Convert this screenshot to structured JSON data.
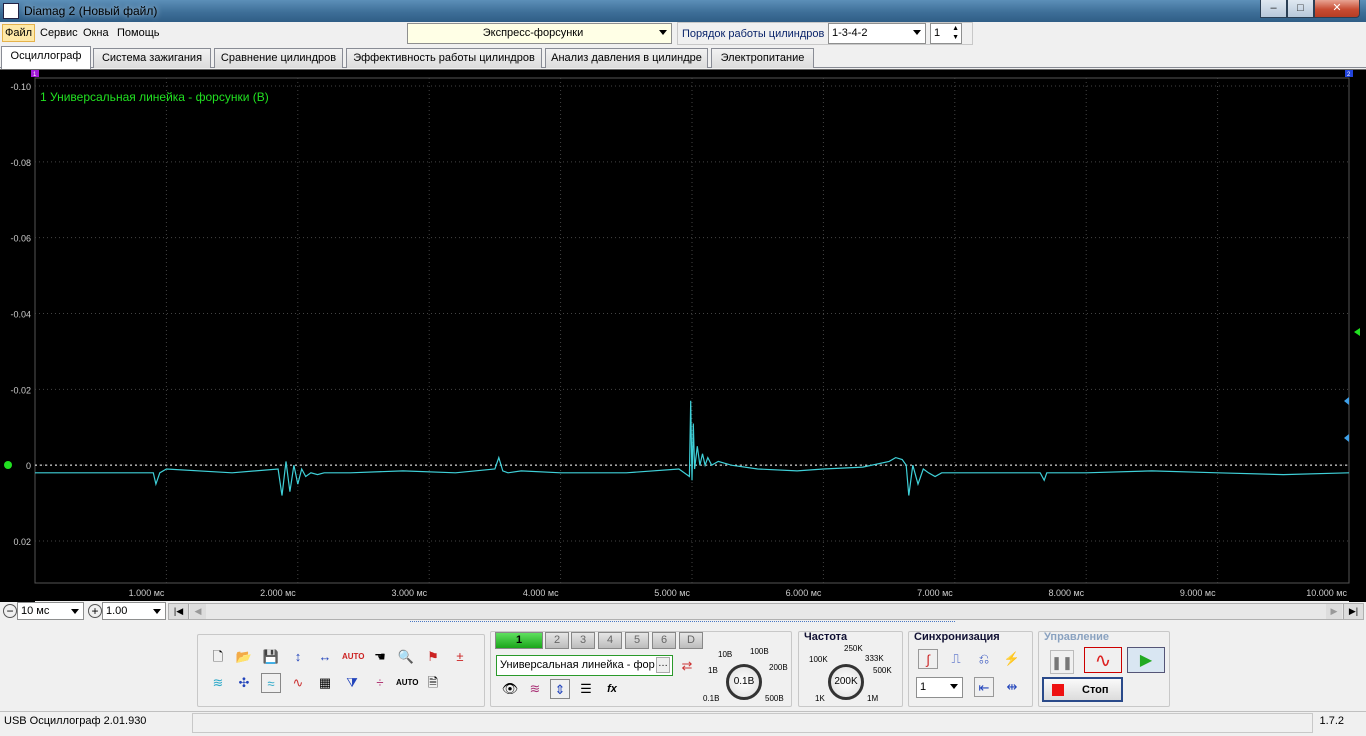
{
  "window": {
    "title": "Diamag 2 (Новый файл)",
    "min": "–",
    "max": "□",
    "close": "✕"
  },
  "menu": [
    "Файл",
    "Сервис",
    "Окна",
    "Помощь"
  ],
  "toolbar": {
    "mode": "Экспресс-форсунки",
    "firing_order_label": "Порядок работы цилиндров",
    "firing_order_value": "1-3-4-2",
    "cylinder_value": "1"
  },
  "tabs": [
    "Осциллограф",
    "Система зажигания",
    "Сравнение цилиндров",
    "Эффективность работы цилиндров",
    "Анализ давления в цилиндре",
    "Электропитание"
  ],
  "chart_data": {
    "type": "line",
    "series_label": "1 Универсальная линейка - форсунки (В)",
    "line_color": "#3fd0d8",
    "label_color": "#21e021",
    "y_ticks": [
      "-0.10",
      "-0.08",
      "-0.06",
      "-0.04",
      "-0.02",
      "0",
      "0.02"
    ],
    "y_range": [
      -0.1,
      0.03
    ],
    "x_ticks": [
      "1.000 мс",
      "2.000 мс",
      "3.000 мс",
      "4.000 мс",
      "5.000 мс",
      "6.000 мс",
      "7.000 мс",
      "8.000 мс",
      "9.000 мс",
      "10.000 мс"
    ],
    "x_range": [
      0,
      10
    ],
    "grid": true,
    "markers": {
      "left_ch": "1",
      "right_ch": "2"
    },
    "series": [
      {
        "x": [
          0,
          0.3,
          0.9,
          0.92,
          0.95,
          1.0,
          1.5,
          1.85,
          1.88,
          1.91,
          1.94,
          1.97,
          2.0,
          2.03,
          2.06,
          2.1,
          2.15,
          2.2,
          2.4,
          2.8,
          3.2,
          3.5,
          3.53,
          3.56,
          3.6,
          3.7,
          4.0,
          4.5,
          4.9,
          4.98,
          4.99,
          5.0,
          5.01,
          5.02,
          5.04,
          5.06,
          5.08,
          5.1,
          5.12,
          5.15,
          5.2,
          5.3,
          5.5,
          5.8,
          6.0,
          6.3,
          6.5,
          6.55,
          6.6,
          6.63,
          6.65,
          6.68,
          6.72,
          6.76,
          6.8,
          6.85,
          6.9,
          7.0,
          7.2,
          7.5,
          7.65,
          7.68,
          7.7,
          7.8,
          8.0,
          8.5,
          9.0,
          9.5,
          10.0
        ],
        "y": [
          0.002,
          0.002,
          0.002,
          0.005,
          0.002,
          0.001,
          0.002,
          0.001,
          0.008,
          -0.001,
          0.007,
          0.0,
          0.005,
          0.001,
          0.003,
          0.002,
          0.0025,
          0.002,
          0.002,
          0.0015,
          0.002,
          0.001,
          -0.002,
          0.0015,
          0.002,
          0.0015,
          0.002,
          0.002,
          0.001,
          0.003,
          -0.017,
          0.004,
          -0.011,
          0.001,
          -0.005,
          0.0,
          -0.003,
          0.0,
          -0.002,
          0.0,
          -0.001,
          0.0,
          0.001,
          0.0015,
          0.001,
          0.0005,
          -0.001,
          -0.002,
          -0.0015,
          0.0,
          0.008,
          0.0,
          0.005,
          0.001,
          0.002,
          0.003,
          0.002,
          0.002,
          0.002,
          0.002,
          0.002,
          0.004,
          0.002,
          0.002,
          0.002,
          0.0015,
          0.002,
          0.0025,
          0.002
        ]
      }
    ]
  },
  "bottom": {
    "timebase": "10 мс",
    "voltage": "1.00",
    "channels": [
      "1",
      "2",
      "3",
      "4",
      "5",
      "6",
      "D"
    ],
    "probe": "Универсальная линейка - фор",
    "probe_more": "…",
    "volt_knob": {
      "center": "0.1B",
      "labels": [
        "10B",
        "100B",
        "1B",
        "200B",
        "0.1B",
        "500B"
      ]
    },
    "freq_title": "Частота",
    "freq_knob": {
      "center": "200K",
      "labels": [
        "250K",
        "100K",
        "333K",
        "500K",
        "1K",
        "1M"
      ]
    },
    "sync_title": "Синхронизация",
    "sync_value": "1",
    "control_title": "Управление",
    "stop_label": "Стоп"
  },
  "status": {
    "left": "USB Осциллограф  2.01.930",
    "right": "1.7.2"
  }
}
